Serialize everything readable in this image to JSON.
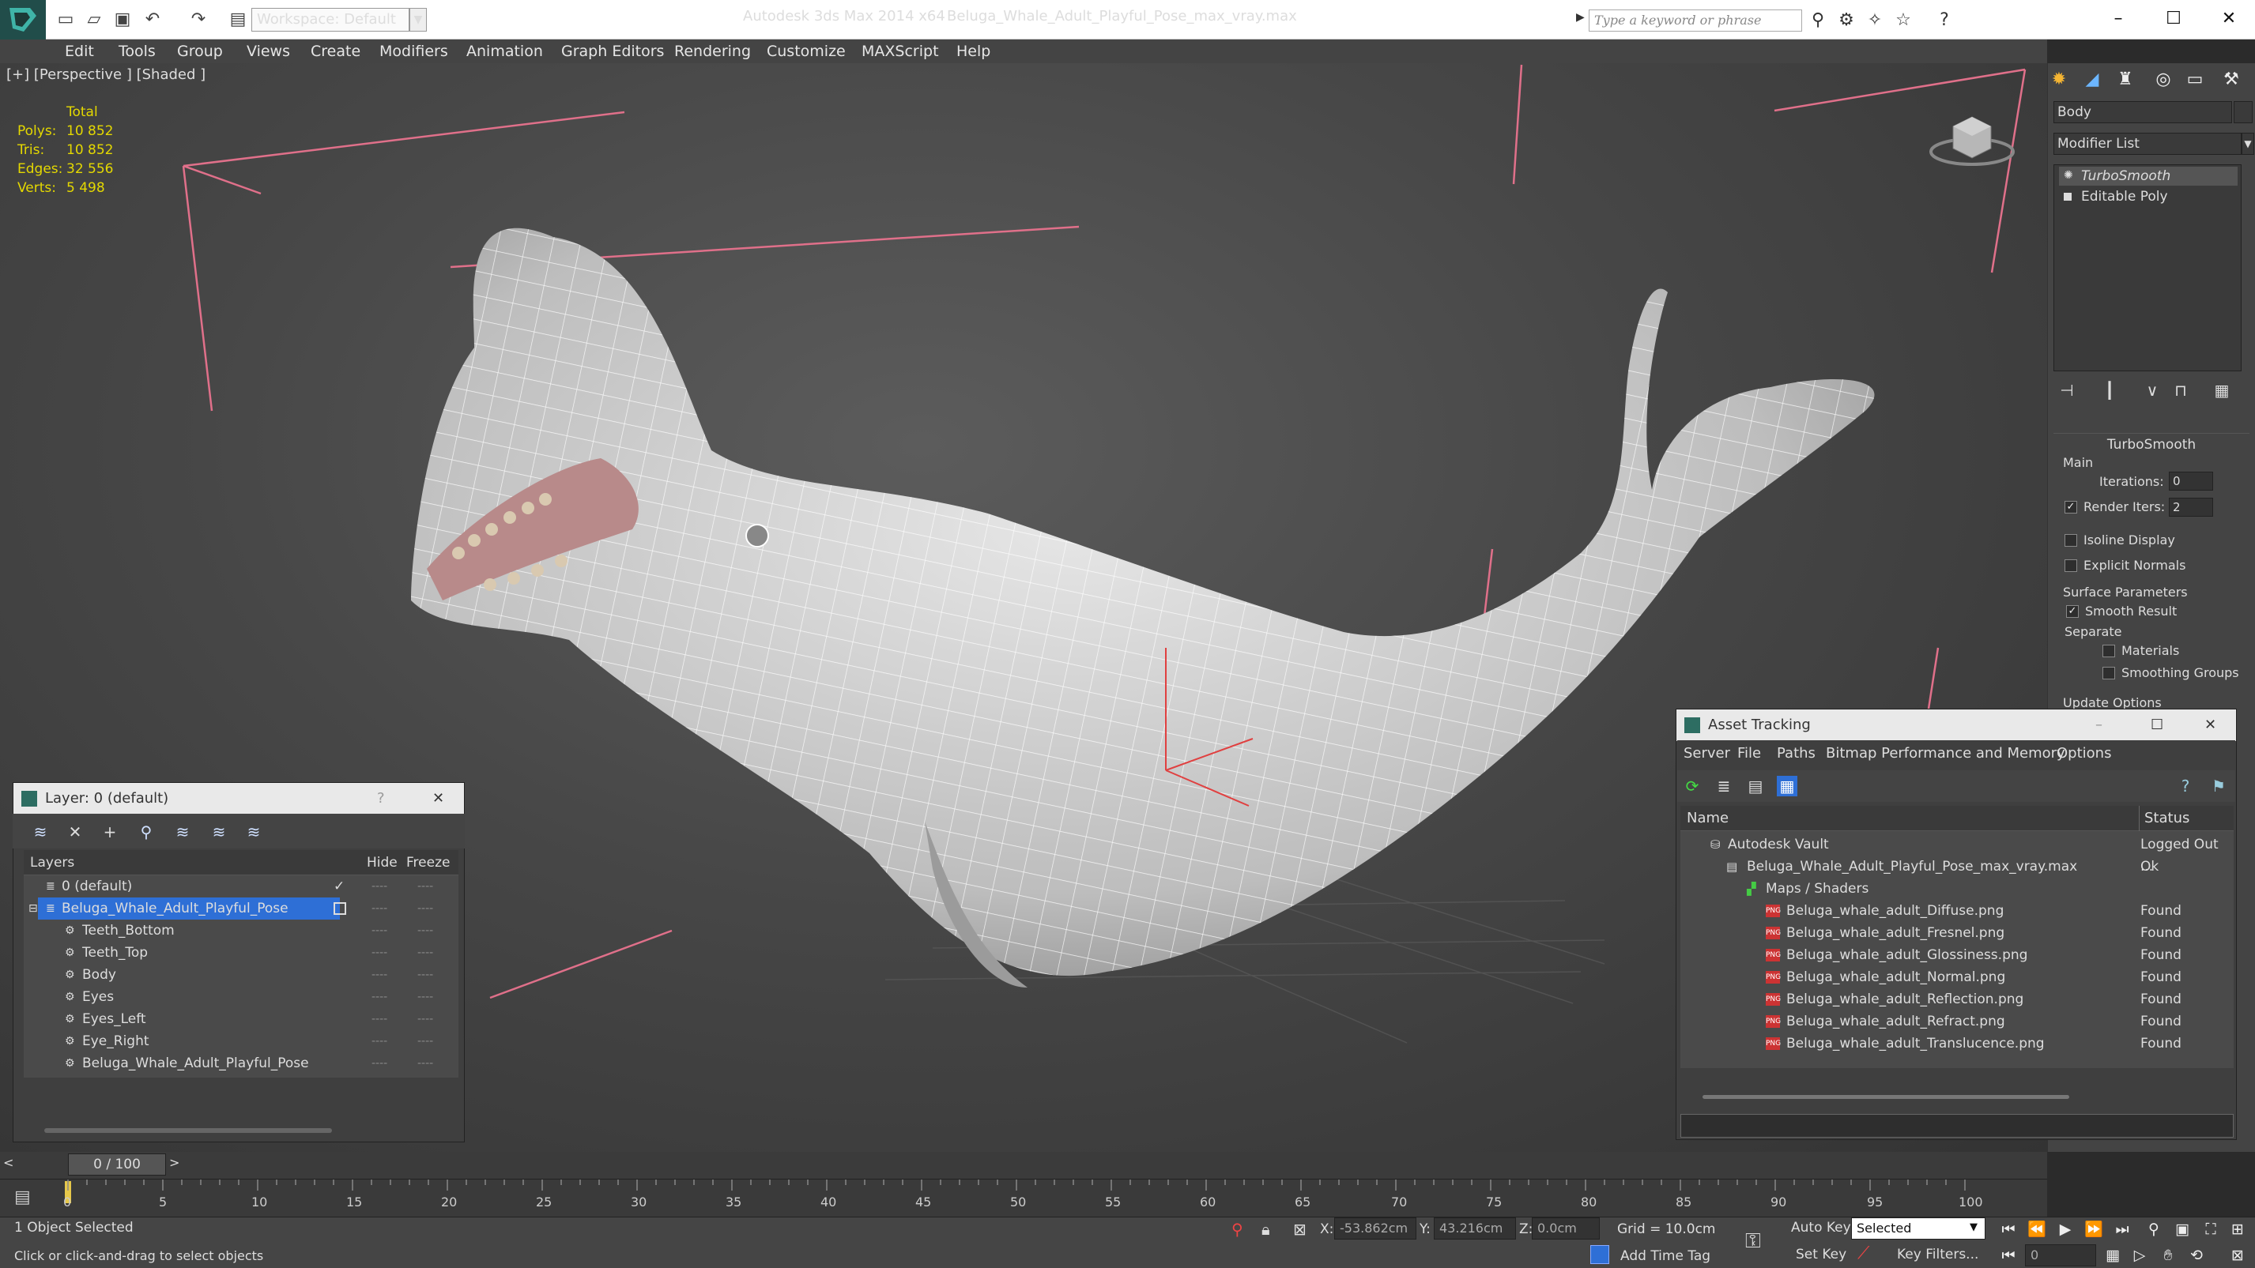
{
  "titlebar": {
    "workspace": "Workspace: Default",
    "app_title": "Autodesk 3ds Max  2014 x64",
    "file_title": "Beluga_Whale_Adult_Playful_Pose_max_vray.max",
    "search_placeholder": "Type a keyword or phrase"
  },
  "menubar": [
    "Edit",
    "Tools",
    "Group",
    "Views",
    "Create",
    "Modifiers",
    "Animation",
    "Graph Editors",
    "Rendering",
    "Customize",
    "MAXScript",
    "Help"
  ],
  "viewport": {
    "label": "[+] [Perspective ] [Shaded ]",
    "stats": {
      "total": "Total",
      "polys_label": "Polys:",
      "polys": "10 852",
      "tris_label": "Tris:",
      "tris": "10 852",
      "edges_label": "Edges:",
      "edges": "32 556",
      "verts_label": "Verts:",
      "verts": "5 498"
    }
  },
  "command_panel": {
    "object_name": "Body",
    "modifier_list": "Modifier List",
    "stack": [
      "TurboSmooth",
      "Editable Poly"
    ],
    "rollout": "TurboSmooth",
    "main": "Main",
    "iterations_label": "Iterations:",
    "iterations": "0",
    "render_iters_label": "Render Iters:",
    "render_iters": "2",
    "isoline": "Isoline Display",
    "explicit_normals": "Explicit Normals",
    "surface_params": "Surface Parameters",
    "smooth_result": "Smooth Result",
    "separate": "Separate",
    "materials": "Materials",
    "smoothing_groups": "Smoothing Groups",
    "update_options": "Update Options"
  },
  "layers": {
    "title": "Layer: 0 (default)",
    "help": "?",
    "close": "✕",
    "col_layers": "Layers",
    "col_hide": "Hide",
    "col_freeze": "Freeze",
    "rows": [
      "0 (default)",
      "Beluga_Whale_Adult_Playful_Pose",
      "Teeth_Bottom",
      "Teeth_Top",
      "Body",
      "Eyes",
      "Eyes_Left",
      "Eye_Right",
      "Beluga_Whale_Adult_Playful_Pose"
    ]
  },
  "asset_tracking": {
    "title": "Asset Tracking",
    "menu": [
      "Server",
      "File",
      "Paths",
      "Bitmap Performance and Memory",
      "Options"
    ],
    "col_name": "Name",
    "col_status": "Status",
    "rows": [
      {
        "name": "Autodesk Vault",
        "status": "Logged Out ..."
      },
      {
        "name": "Beluga_Whale_Adult_Playful_Pose_max_vray.max",
        "status": "Ok"
      },
      {
        "name": "Maps / Shaders",
        "status": ""
      },
      {
        "name": "Beluga_whale_adult_Diffuse.png",
        "status": "Found"
      },
      {
        "name": "Beluga_whale_adult_Fresnel.png",
        "status": "Found"
      },
      {
        "name": "Beluga_whale_adult_Glossiness.png",
        "status": "Found"
      },
      {
        "name": "Beluga_whale_adult_Normal.png",
        "status": "Found"
      },
      {
        "name": "Beluga_whale_adult_Reflection.png",
        "status": "Found"
      },
      {
        "name": "Beluga_whale_adult_Refract.png",
        "status": "Found"
      },
      {
        "name": "Beluga_whale_adult_Translucence.png",
        "status": "Found"
      }
    ]
  },
  "timeline": {
    "slider": "0 / 100",
    "ticks": [
      "0",
      "5",
      "10",
      "15",
      "20",
      "25",
      "30",
      "35",
      "40",
      "45",
      "50",
      "55",
      "60",
      "65",
      "70",
      "75",
      "80",
      "85",
      "90",
      "95",
      "100"
    ]
  },
  "status": {
    "selected": "1 Object Selected",
    "prompt": "Click or click-and-drag to select objects",
    "x_label": "X:",
    "x": "-53.862cm",
    "y_label": "Y:",
    "y": "43.216cm",
    "z_label": "Z:",
    "z": "0.0cm",
    "grid": "Grid = 10.0cm",
    "add_time_tag": "Add Time Tag",
    "auto_key": "Auto Key",
    "set_key": "Set Key",
    "selected_dropdown": "Selected",
    "key_filters": "Key Filters...",
    "frame": "0"
  },
  "colors": {
    "accent": "#2e6fd6",
    "stats": "#e4d800",
    "bounding": "#e0708a"
  }
}
